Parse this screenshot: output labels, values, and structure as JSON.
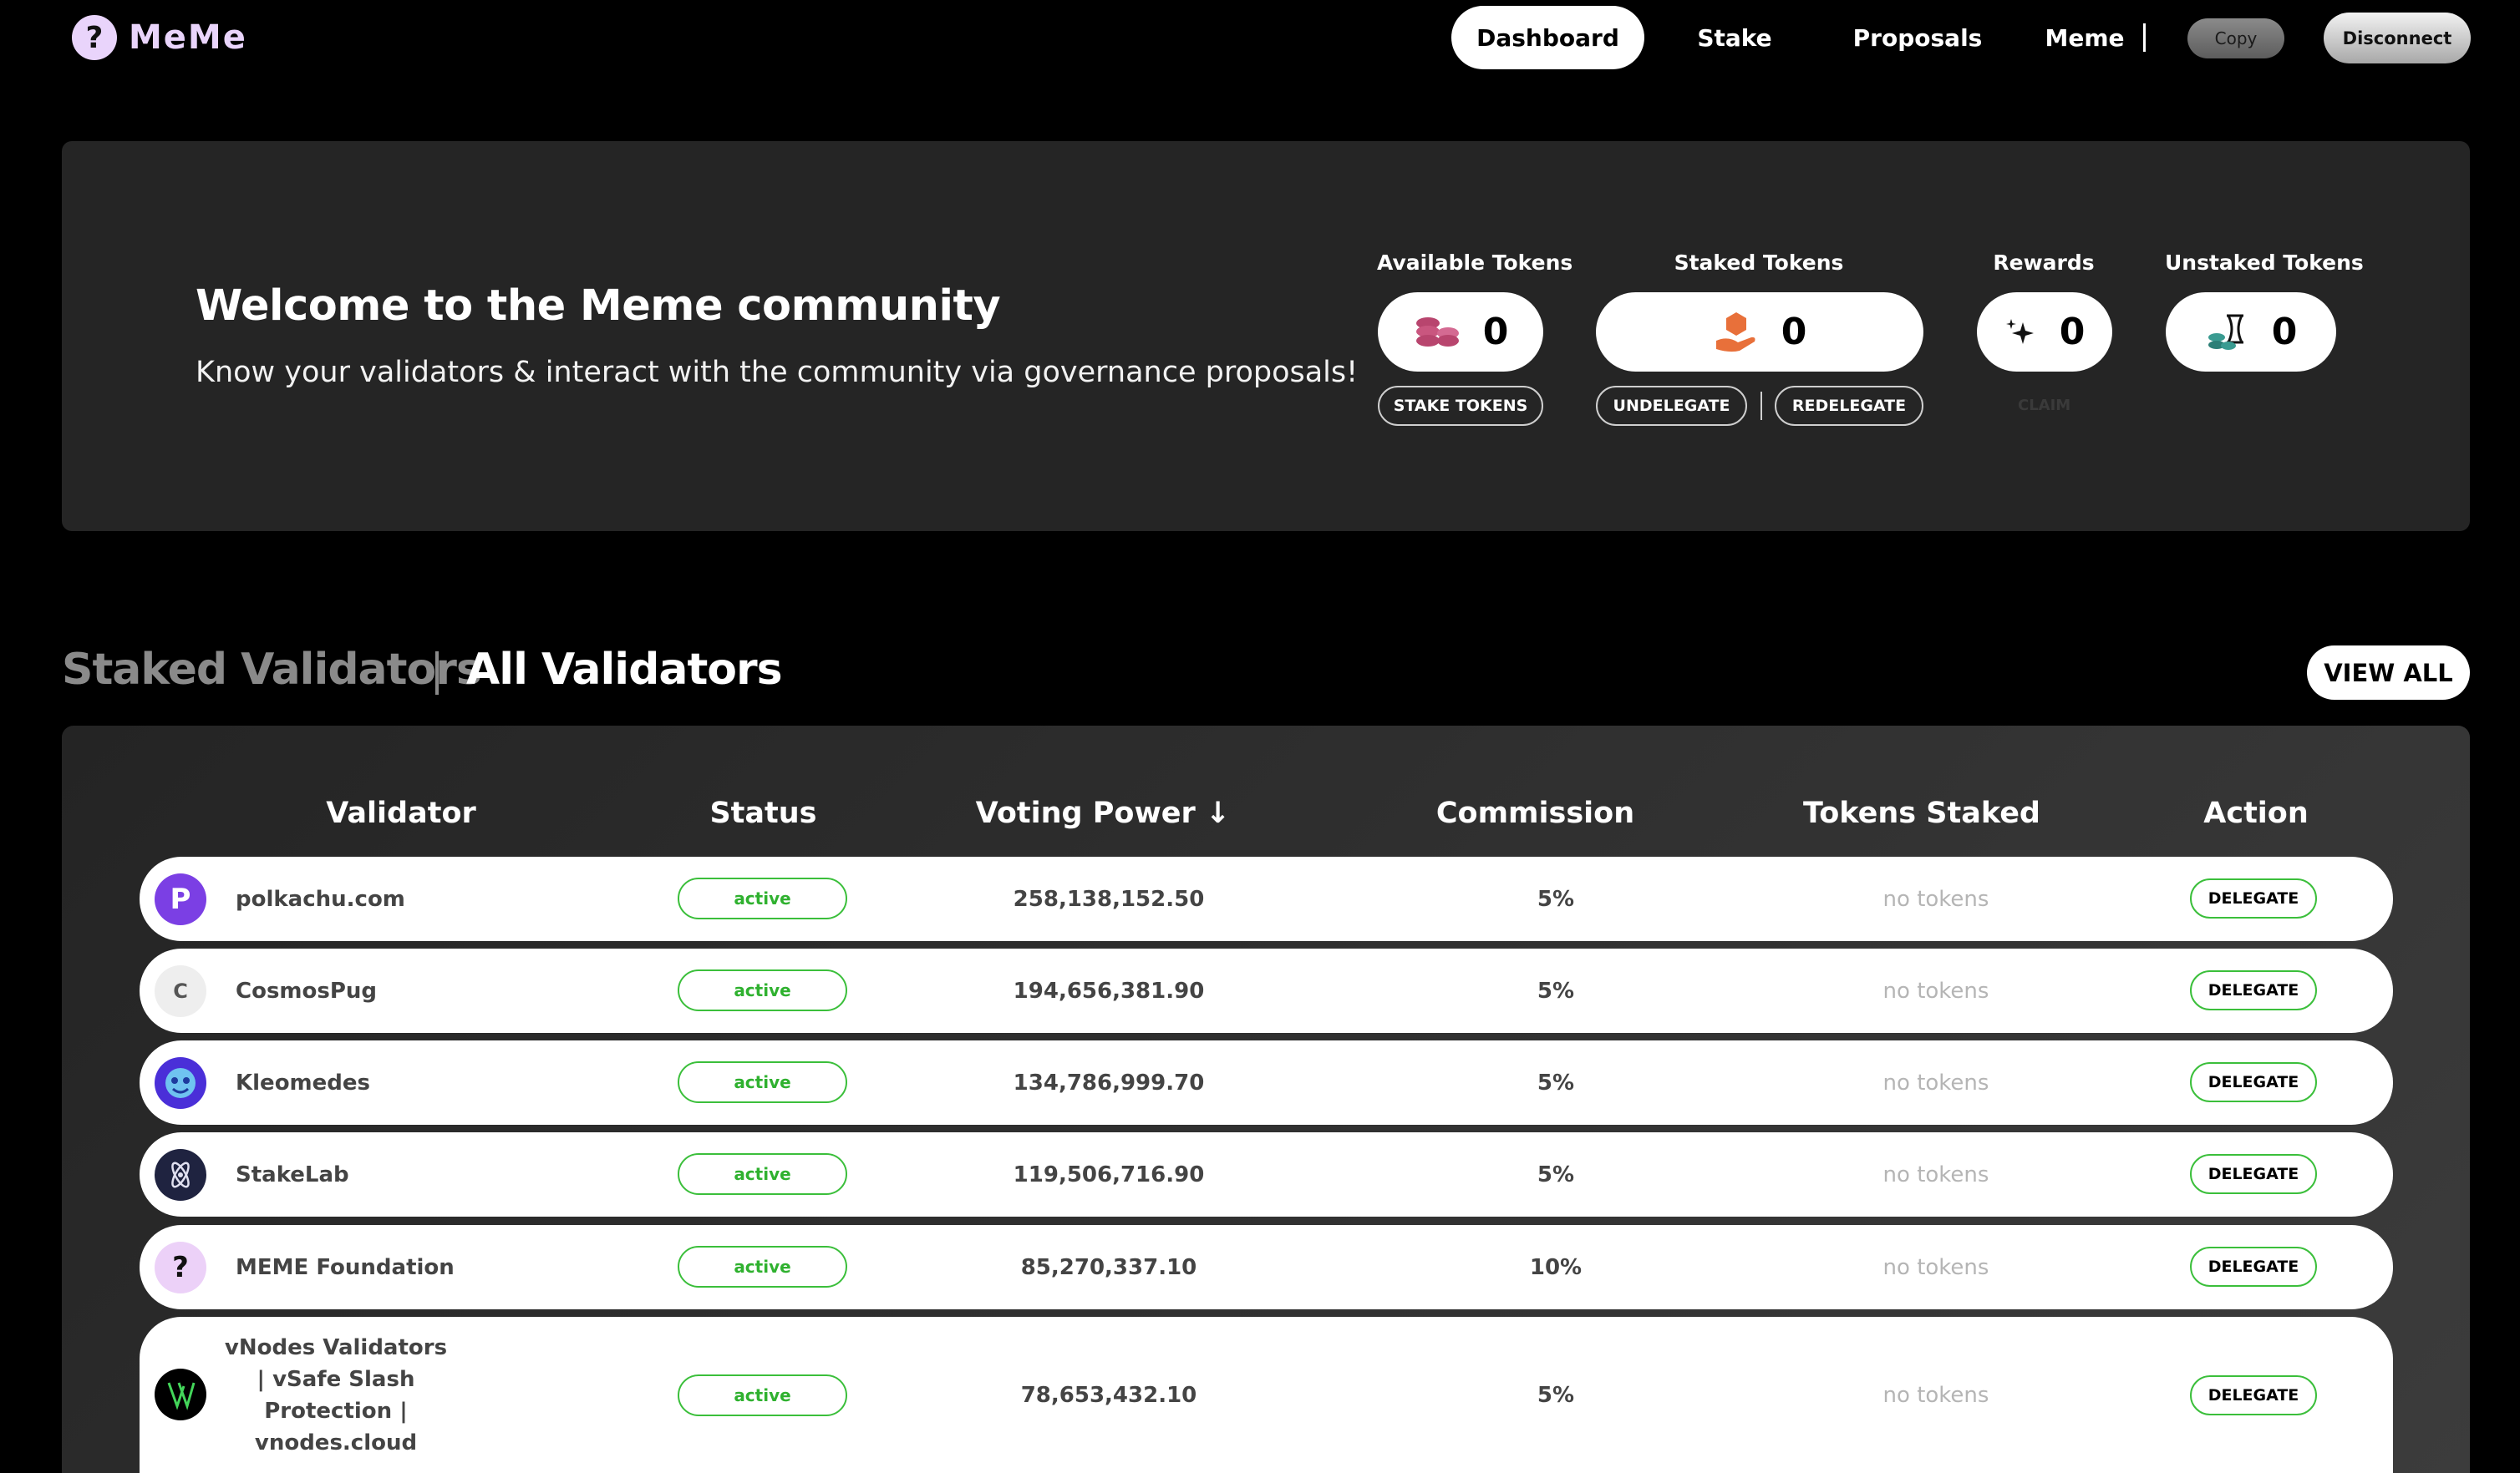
{
  "nav": {
    "logo_text": "MeMe",
    "links": [
      "Dashboard",
      "Stake",
      "Proposals",
      "Meme"
    ],
    "copy_label": "Copy",
    "disconnect_label": "Disconnect"
  },
  "hero": {
    "title": "Welcome to the Meme community",
    "subtitle": "Know your validators & interact with the community via governance proposals!",
    "stats": {
      "available": {
        "label": "Available Tokens",
        "value": "0",
        "button": "STAKE TOKENS"
      },
      "staked": {
        "label": "Staked Tokens",
        "value": "0",
        "button_undelegate": "UNDELEGATE",
        "button_redelegate": "REDELEGATE"
      },
      "rewards": {
        "label": "Rewards",
        "value": "0",
        "button": "CLAIM"
      },
      "unstaked": {
        "label": "Unstaked Tokens",
        "value": "0"
      }
    }
  },
  "section": {
    "tab_staked": "Staked Validators",
    "tab_all": "All Validators",
    "view_all": "VIEW ALL"
  },
  "table": {
    "headers": [
      "Validator",
      "Status",
      "Voting Power ↓",
      "Commission",
      "Tokens Staked",
      "Action"
    ],
    "rows": [
      {
        "name": "polkachu.com",
        "status": "active",
        "voting_power": "258,138,152.50",
        "commission": "5%",
        "tokens": "no tokens",
        "action": "DELEGATE",
        "avatar": "P"
      },
      {
        "name": "CosmosPug",
        "status": "active",
        "voting_power": "194,656,381.90",
        "commission": "5%",
        "tokens": "no tokens",
        "action": "DELEGATE",
        "avatar": "C"
      },
      {
        "name": "Kleomedes",
        "status": "active",
        "voting_power": "134,786,999.70",
        "commission": "5%",
        "tokens": "no tokens",
        "action": "DELEGATE",
        "avatar": ""
      },
      {
        "name": "StakeLab",
        "status": "active",
        "voting_power": "119,506,716.90",
        "commission": "5%",
        "tokens": "no tokens",
        "action": "DELEGATE",
        "avatar": ""
      },
      {
        "name": "MEME Foundation",
        "status": "active",
        "voting_power": "85,270,337.10",
        "commission": "10%",
        "tokens": "no tokens",
        "action": "DELEGATE",
        "avatar": "?"
      },
      {
        "name_lines": [
          "vNodes Validators",
          "| vSafe Slash",
          "Protection |",
          "vnodes.cloud"
        ],
        "status": "active",
        "voting_power": "78,653,432.10",
        "commission": "5%",
        "tokens": "no tokens",
        "action": "DELEGATE",
        "avatar": ""
      }
    ]
  },
  "colors": {
    "background": "#000000",
    "panel": "#252525",
    "accent_lilac": "#e9d4fb",
    "status_green": "#3bbf3b"
  }
}
